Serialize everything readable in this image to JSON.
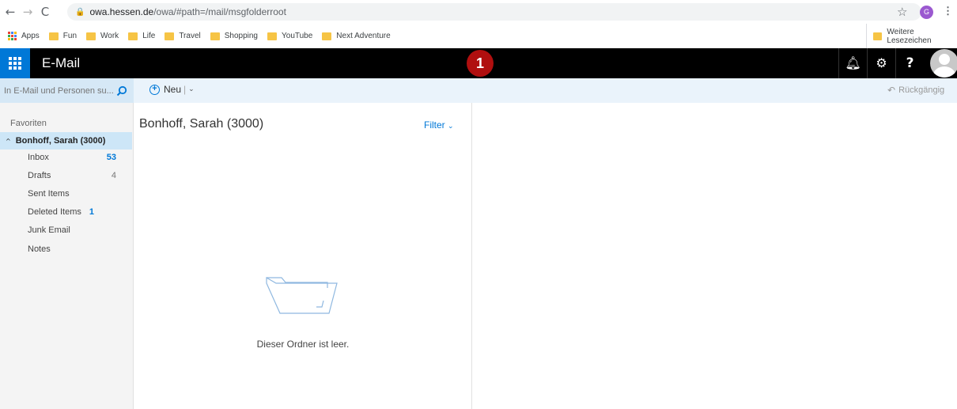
{
  "browser": {
    "nav": {
      "back": "←",
      "forward": "→",
      "reload": "C"
    },
    "url_host": "owa.hessen.de",
    "url_path": "/owa/#path=/mail/msgfolderroot",
    "profile_initial": "G",
    "bookmarks": [
      {
        "label": "Apps"
      },
      {
        "label": "Fun"
      },
      {
        "label": "Work"
      },
      {
        "label": "Life"
      },
      {
        "label": "Travel"
      },
      {
        "label": "Shopping"
      },
      {
        "label": "YouTube"
      },
      {
        "label": "Next Adventure"
      }
    ],
    "other_bookmarks": "Weitere Lesezeichen"
  },
  "header": {
    "title": "E-Mail",
    "badge_number": "1",
    "accent_color": "#0078d7"
  },
  "command_bar": {
    "search_placeholder": "In E-Mail und Personen su...",
    "new_label": "Neu",
    "undo_label": "Rückgängig"
  },
  "folders": {
    "favorites_label": "Favoriten",
    "account_label": "Bonhoff, Sarah (3000)",
    "items": [
      {
        "label": "Inbox",
        "count": "53"
      },
      {
        "label": "Drafts",
        "count": "4"
      },
      {
        "label": "Sent Items",
        "count": ""
      },
      {
        "label": "Deleted Items",
        "count": "1"
      },
      {
        "label": "Junk Email",
        "count": ""
      },
      {
        "label": "Notes",
        "count": ""
      }
    ]
  },
  "message_list": {
    "title": "Bonhoff, Sarah (3000)",
    "filter_label": "Filter",
    "empty_text": "Dieser Ordner ist leer."
  }
}
